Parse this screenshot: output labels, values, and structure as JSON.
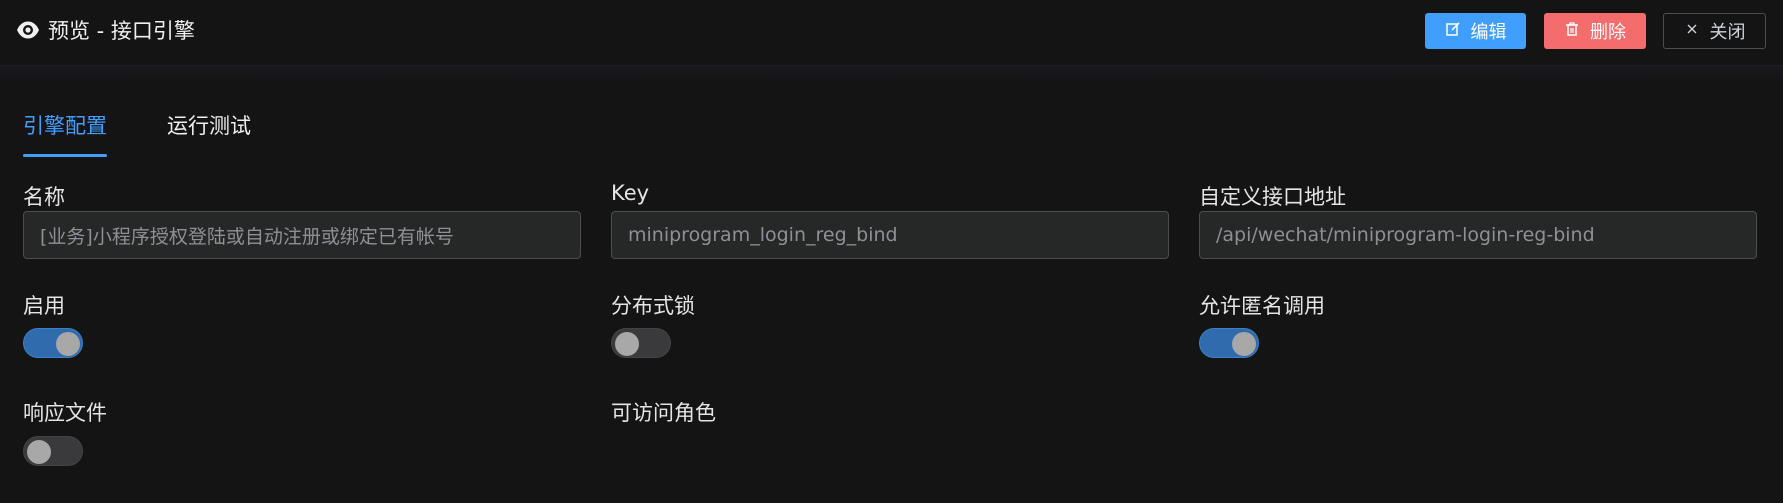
{
  "header": {
    "title": "预览 - 接口引擎",
    "edit_label": "编辑",
    "delete_label": "删除",
    "close_label": "关闭"
  },
  "tabs": [
    {
      "label": "引擎配置",
      "active": true
    },
    {
      "label": "运行测试",
      "active": false
    }
  ],
  "form": {
    "name_label": "名称",
    "name_value": "[业务]小程序授权登陆或自动注册或绑定已有帐号",
    "key_label": "Key",
    "key_value": "miniprogram_login_reg_bind",
    "path_label": "自定义接口地址",
    "path_value": "/api/wechat/miniprogram-login-reg-bind",
    "enabled_label": "启用",
    "enabled": true,
    "lock_label": "分布式锁",
    "lock": false,
    "anonymous_label": "允许匿名调用",
    "anonymous": true,
    "response_file_label": "响应文件",
    "response_file": false,
    "roles_label": "可访问角色"
  },
  "colors": {
    "primary": "#409eff",
    "danger": "#f56c6c",
    "background": "#141414",
    "switch_on": "#2f6bad"
  },
  "icons": [
    "eye-icon",
    "edit-icon",
    "trash-icon",
    "close-icon"
  ]
}
